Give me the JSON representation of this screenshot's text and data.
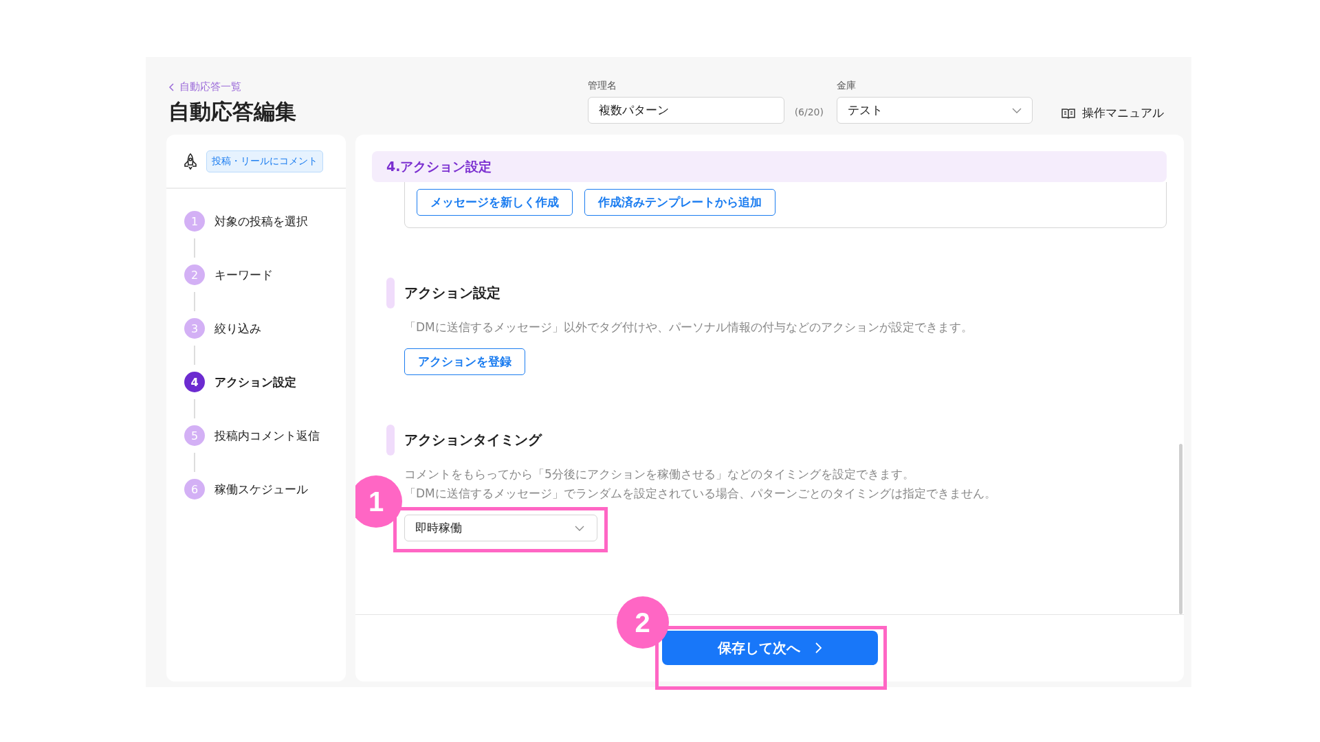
{
  "header": {
    "back_link": "自動応答一覧",
    "title": "自動応答編集",
    "name_field": {
      "label": "管理名",
      "value": "複数パターン",
      "counter": "(6/20)"
    },
    "vault_field": {
      "label": "金庫",
      "value": "テスト"
    },
    "manual_link": "操作マニュアル"
  },
  "sidebar": {
    "trigger_tag": "投稿・リールにコメント",
    "steps": [
      {
        "number": "1",
        "label": "対象の投稿を選択",
        "selected": false
      },
      {
        "number": "2",
        "label": "キーワード",
        "selected": false
      },
      {
        "number": "3",
        "label": "絞り込み",
        "selected": false
      },
      {
        "number": "4",
        "label": "アクション設定",
        "selected": true
      },
      {
        "number": "5",
        "label": "投稿内コメント返信",
        "selected": false
      },
      {
        "number": "6",
        "label": "稼働スケジュール",
        "selected": false
      }
    ]
  },
  "section": {
    "title": "4.アクション設定",
    "message_buttons": [
      "メッセージを新しく作成",
      "作成済みテンプレートから追加"
    ],
    "blocks": [
      {
        "kind": "button",
        "heading": "アクション設定",
        "description": [
          "「DMに送信するメッセージ」以外でタグ付けや、パーソナル情報の付与などのアクションが設定できます。"
        ],
        "button": "アクションを登録"
      },
      {
        "kind": "select",
        "heading": "アクションタイミング",
        "description": [
          "コメントをもらってから「5分後にアクションを稼働させる」などのタイミングを設定できます。",
          "「DMに送信するメッセージ」でランダムを設定されている場合、パターンごとのタイミングは指定できません。"
        ],
        "select": "即時稼働",
        "annotation": "1"
      }
    ]
  },
  "footer": {
    "save_button": "保存して次へ",
    "annotation": "2"
  }
}
